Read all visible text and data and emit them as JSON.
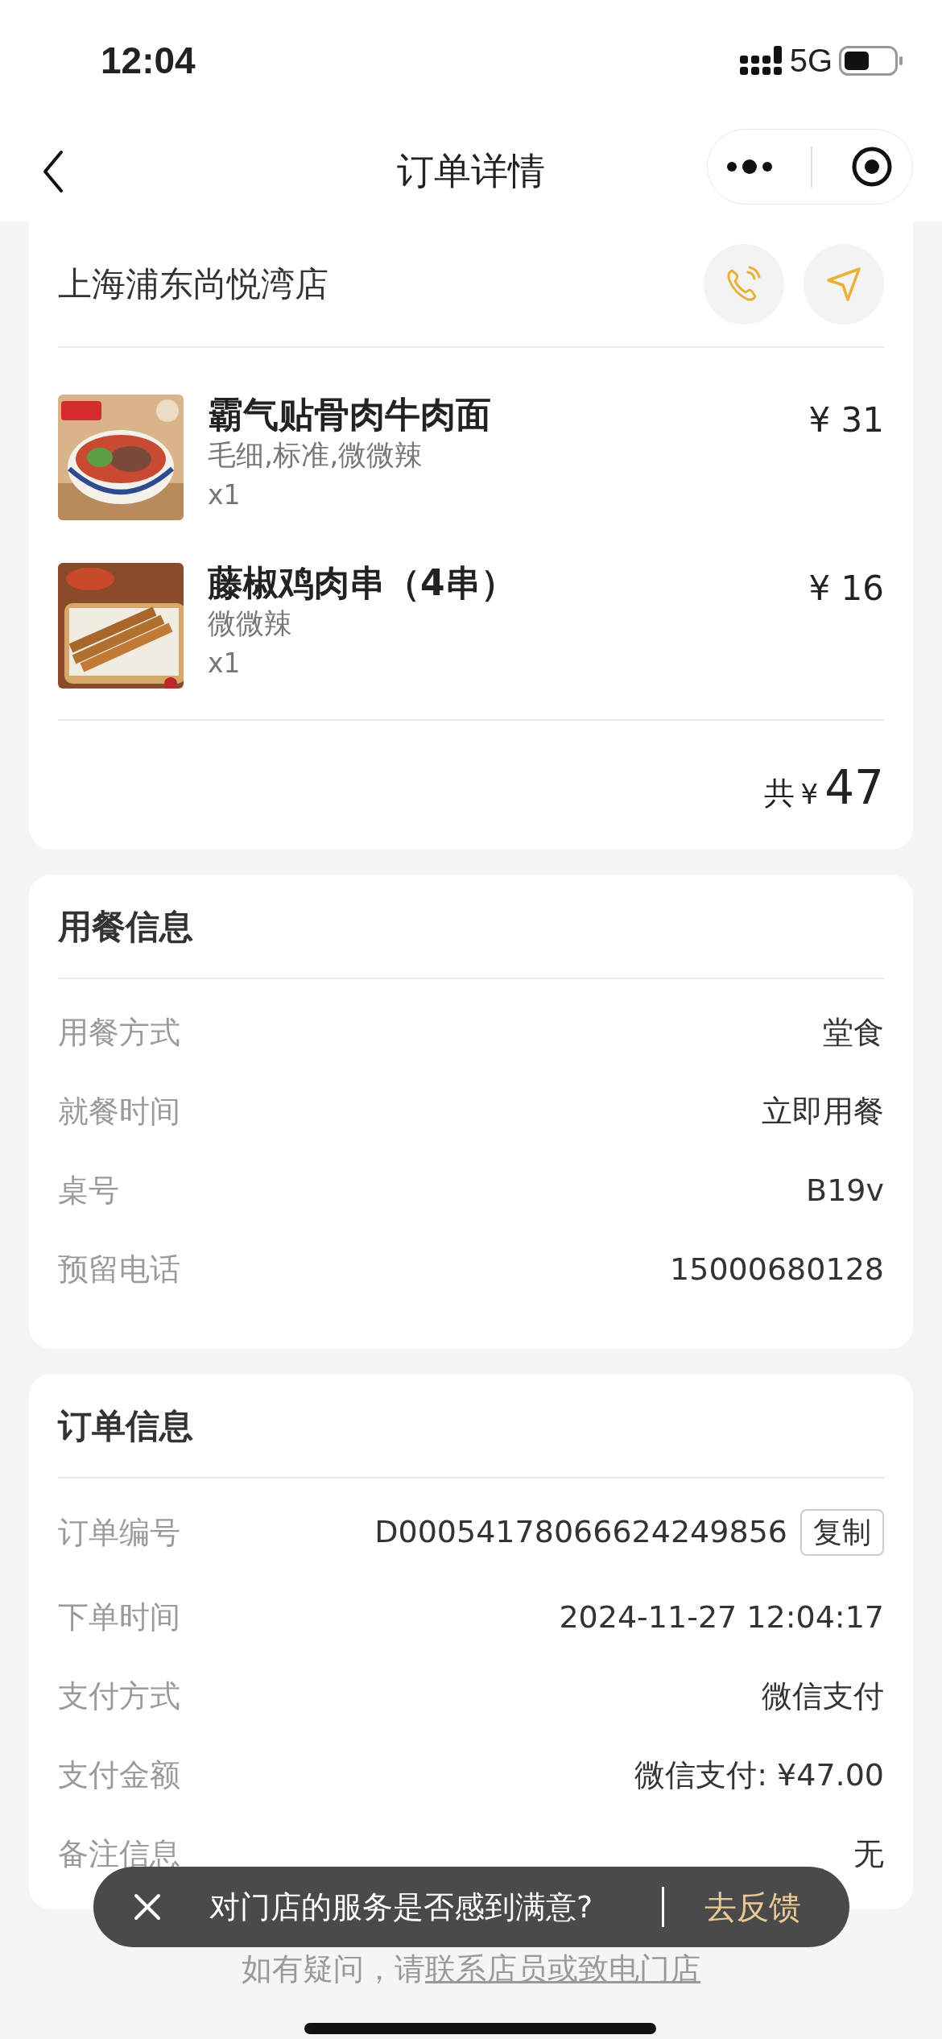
{
  "status_bar": {
    "time": "12:04",
    "network": "5G"
  },
  "nav": {
    "title": "订单详情"
  },
  "store": {
    "name": "上海浦东尚悦湾店"
  },
  "items": [
    {
      "kind": "picture",
      "name": "霸气贴骨肉牛肉面",
      "options": "毛细,标准,微微辣",
      "quantity": "x1",
      "price": "¥ 31"
    },
    {
      "kind": "picture",
      "name": "藤椒鸡肉串（4串）",
      "options": "微微辣",
      "quantity": "x1",
      "price": "¥ 16"
    }
  ],
  "total": {
    "label": "共",
    "currency": "¥",
    "amount": "47"
  },
  "dining_info": {
    "title": "用餐信息",
    "rows": [
      {
        "label": "用餐方式",
        "value": "堂食"
      },
      {
        "label": "就餐时间",
        "value": "立即用餐"
      },
      {
        "label": "桌号",
        "value": "B19v"
      },
      {
        "label": "预留电话",
        "value": "15000680128"
      }
    ]
  },
  "order_info": {
    "title": "订单信息",
    "rows": [
      {
        "label": "订单编号",
        "value": "D00054178066624249856",
        "button": "复制"
      },
      {
        "label": "下单时间",
        "value": "2024-11-27 12:04:17"
      },
      {
        "label": "支付方式",
        "value": "微信支付"
      },
      {
        "label": "支付金额",
        "value": "微信支付: ¥47.00"
      },
      {
        "label": "备注信息",
        "value": "无"
      }
    ]
  },
  "toast": {
    "message": "对门店的服务是否感到满意?",
    "action": "去反馈"
  },
  "footer": {
    "text": "如有疑问，请",
    "link": "联系店员或致电门店"
  }
}
